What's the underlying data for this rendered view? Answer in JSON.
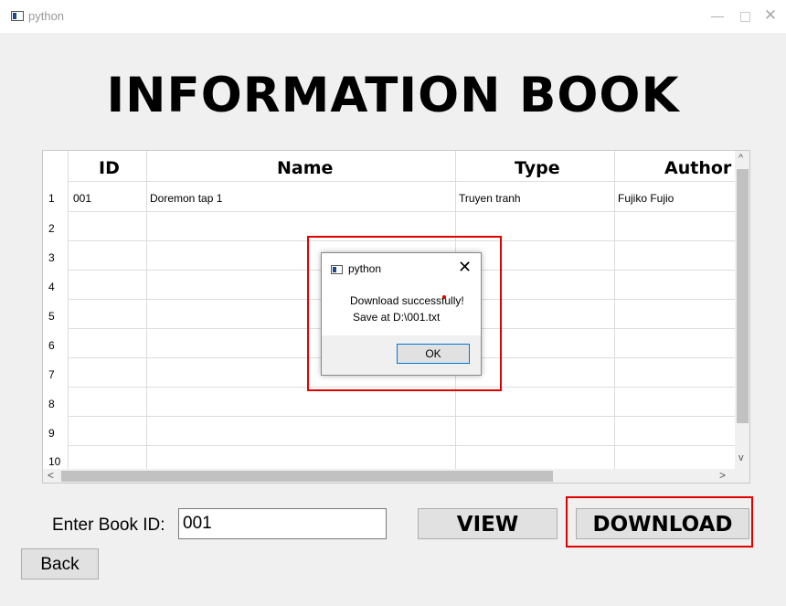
{
  "window": {
    "title": "python"
  },
  "main_title": "INFORMATION BOOK",
  "table": {
    "columns": [
      "ID",
      "Name",
      "Type",
      "Author"
    ],
    "row_numbers": [
      "1",
      "2",
      "3",
      "4",
      "5",
      "6",
      "7",
      "8",
      "9",
      "10"
    ],
    "rows": [
      [
        "001",
        "Doremon tap 1",
        "Truyen tranh",
        "Fujiko Fujio"
      ]
    ]
  },
  "controls": {
    "enter_label": "Enter Book ID:",
    "book_id_value": "001",
    "view_label": "VIEW",
    "download_label": "DOWNLOAD",
    "back_label": "Back"
  },
  "dialog": {
    "title": "python",
    "message_line1": "Download successfully!",
    "message_line2": "Save at D:\\001.txt",
    "ok_label": "OK"
  },
  "colors": {
    "highlight": "#e00000",
    "focus_border": "#0078d7"
  }
}
